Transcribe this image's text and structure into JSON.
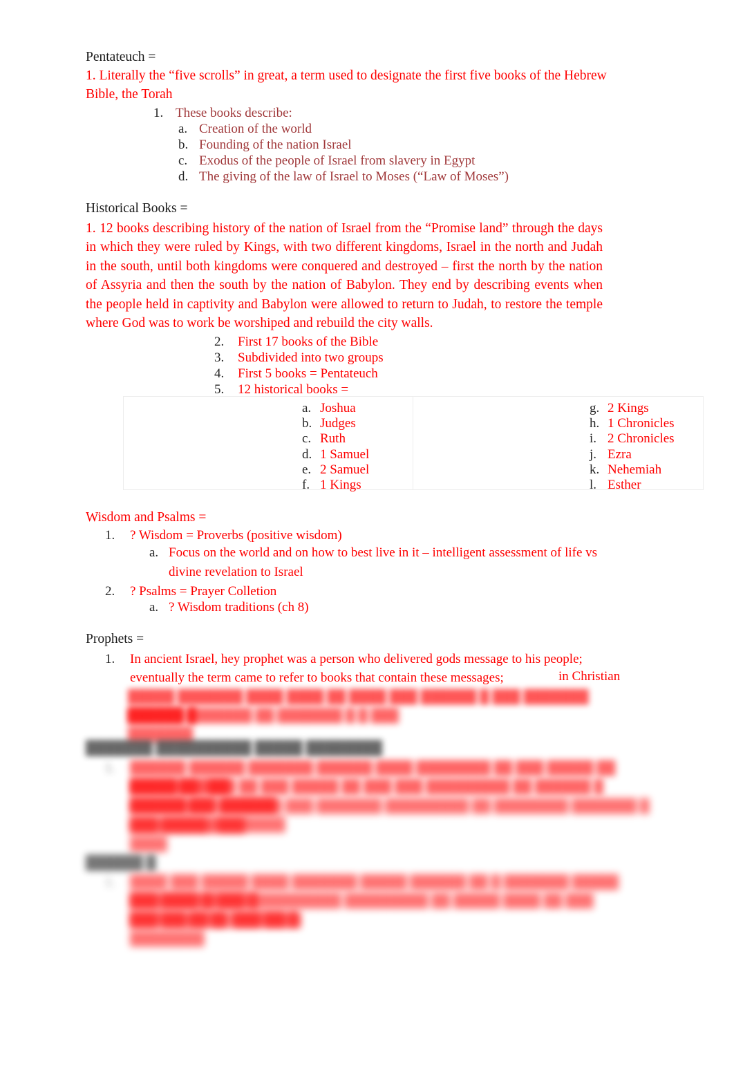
{
  "document": {
    "sections": [
      {
        "heading": "Pentateuch =",
        "heading_color": "#1a1a1a",
        "lead": {
          "number": "1.",
          "text": "Literally the “five scrolls” in great, a term used to designate the first five books of the Hebrew Bible, the Torah"
        },
        "sub": {
          "marker": "1.",
          "label": "These books describe:",
          "items": [
            {
              "marker": "a.",
              "text": "Creation of the world"
            },
            {
              "marker": "b.",
              "text": "Founding of the nation Israel"
            },
            {
              "marker": "c.",
              "text": "Exodus of the people of Israel from slavery in Egypt"
            },
            {
              "marker": "d.",
              "text": "The giving of the law of Israel to Moses (“Law of Moses”)"
            }
          ]
        }
      },
      {
        "heading": "Historical Books =",
        "heading_color": "#1a1a1a",
        "lead": {
          "number": "1.",
          "text": "12 books describing history of the nation of Israel from the “Promise land” through the days in which they were ruled by Kings, with two different kingdoms, Israel in the north and Judah in the south, until both kingdoms were conquered and destroyed – first the north by the nation of Assyria and then the south by the nation of Babylon. They end by describing events when the people held in captivity and Babylon were allowed to return to Judah, to restore the temple where God was to work be worshiped and rebuild the city walls."
        },
        "numbered": [
          {
            "marker": "2.",
            "text": "First 17 books of the Bible"
          },
          {
            "marker": "3.",
            "text": "Subdivided into two groups"
          },
          {
            "marker": "4.",
            "text": "First 5 books = Pentateuch"
          },
          {
            "marker": "5.",
            "text": "12 historical books ="
          }
        ],
        "books_box": {
          "left_column": [
            {
              "marker": "a.",
              "text": "Joshua"
            },
            {
              "marker": "b.",
              "text": "Judges"
            },
            {
              "marker": "c.",
              "text": "Ruth"
            },
            {
              "marker": "d.",
              "text": "1 Samuel"
            },
            {
              "marker": "e.",
              "text": "2 Samuel"
            },
            {
              "marker": "f.",
              "text": "1 Kings"
            }
          ],
          "right_column": [
            {
              "marker": "g.",
              "text": "2 Kings"
            },
            {
              "marker": "h.",
              "text": "1 Chronicles"
            },
            {
              "marker": "i.",
              "text": "2 Chronicles"
            },
            {
              "marker": "j.",
              "text": "Ezra"
            },
            {
              "marker": "k.",
              "text": "Nehemiah"
            },
            {
              "marker": "l.",
              "text": "Esther"
            }
          ]
        }
      },
      {
        "heading": "Wisdom and Psalms =",
        "heading_color": "#fe0000",
        "items": [
          {
            "marker": "1.",
            "text": "? Wisdom = Proverbs (positive wisdom)"
          },
          {
            "marker": "a.",
            "text": "Focus on the world and on how to best live in it – intelligent assessment of life vs divine revelation to Israel"
          },
          {
            "marker": "2.",
            "text": "? Psalms = Prayer Colletion"
          },
          {
            "marker": "a.",
            "text": "? Wisdom traditions (ch 8)"
          }
        ]
      },
      {
        "heading": "Prophets =",
        "heading_color": "#1a1a1a",
        "items": [
          {
            "marker": "1.",
            "text": "In ancient Israel, hey prophet was a person who delivered gods message to his people; eventually the term came to refer to books that contain these messages;"
          },
          {
            "marker": "",
            "text": "in Christian"
          }
        ]
      }
    ],
    "obscured": {
      "note": "Remaining lines are blurred beyond legibility in the source image.",
      "prophets_blurred_lines": [
        "█████ ███████ ████ ████ ██ ████ ███ ██████ █ ███ ███████ ██████ █",
        "██████ ███████ ██ ███████ █ █ ███ ███████"
      ],
      "section5_heading": "███████ ██████████ █████ ████████",
      "section5_lines": [
        "██████ ██████ ███████ ██████ ████ ████████ ██ ███ █████ ██ █████ ██ ███",
        "████████ ███ ██ ███ █████ ██ ███ ███ █████████ ██ ██████ █ ██████ ███ ██████",
        "█████████ ███████ ███ ███████ █████████ ██ ████████ ███████ █ ███ █████ ████████",
        "█████████ ███ ████"
      ],
      "section6_heading": "██████ █",
      "section6_lines": [
        "████ ███ █████ ████ ███████ █████ ██████ ██ █ ███████ █████ ███ ████ ██████",
        "█████████ ███ ██████████ █████████ ██ █████ ████ ██ ███ ██████ ████ ██████ █",
        "███ █████ ██ ███ ████ ████████"
      ]
    }
  }
}
